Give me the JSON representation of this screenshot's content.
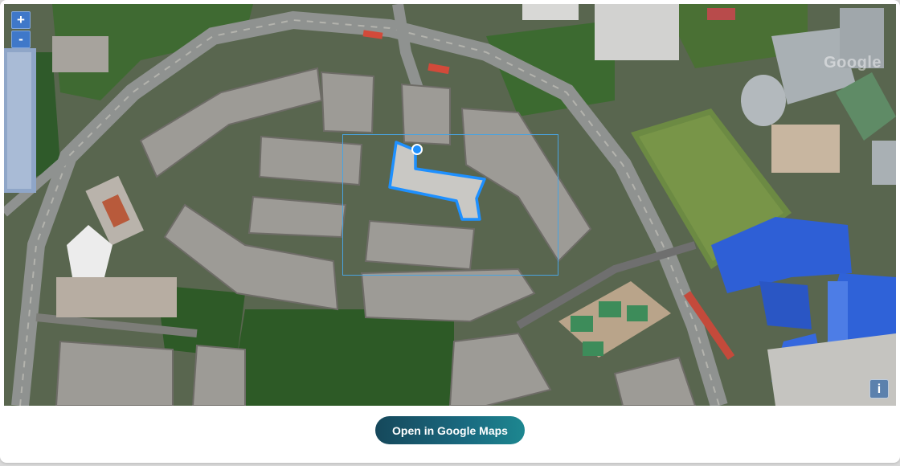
{
  "map": {
    "zoom_in_label": "+",
    "zoom_out_label": "-",
    "attribution_text": "Google",
    "info_label": "i",
    "highlight_color": "#1e90ff",
    "selection_box_color": "#4aa3df"
  },
  "footer": {
    "open_button_label": "Open in Google Maps"
  }
}
